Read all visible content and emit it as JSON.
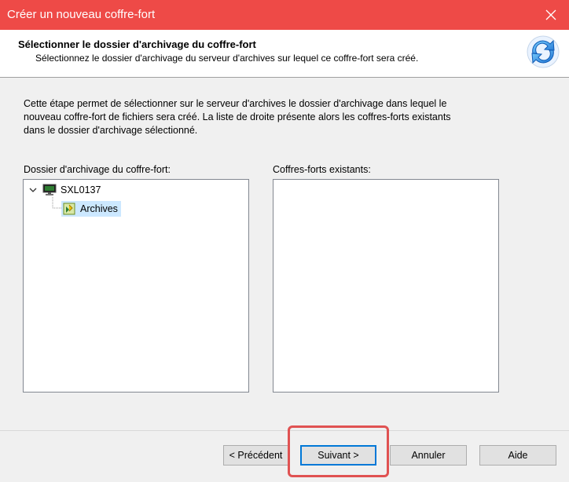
{
  "window": {
    "title": "Créer un nouveau coffre-fort",
    "close_label": "✕"
  },
  "header": {
    "title": "Sélectionner le dossier d'archivage du coffre-fort",
    "subtitle": "Sélectionnez le dossier d'archivage du serveur d'archives sur lequel ce coffre-fort sera créé.",
    "icon": "refresh-arrows-icon"
  },
  "intro": {
    "lines": [
      "Cette étape permet de sélectionner sur le serveur d'archives le dossier d'archivage dans lequel le",
      "nouveau coffre-fort de fichiers sera créé. La liste de droite présente alors les coffres-forts existants",
      "dans le dossier d'archivage sélectionné."
    ]
  },
  "left_panel": {
    "label": "Dossier d'archivage du coffre-fort:",
    "tree": {
      "server": {
        "label": "SXL0137",
        "expanded": true,
        "icon": "monitor-icon"
      },
      "child": {
        "label": "Archives",
        "selected": true,
        "icon": "archive-folder-icon"
      }
    }
  },
  "right_panel": {
    "label": "Coffres-forts existants:",
    "items": []
  },
  "buttons": {
    "back": "< Précédent",
    "next": "Suivant >",
    "cancel": "Annuler",
    "help": "Aide"
  },
  "colors": {
    "titlebar": "#ee4a47",
    "selection": "#cce8ff",
    "annotation": "#e05252"
  }
}
